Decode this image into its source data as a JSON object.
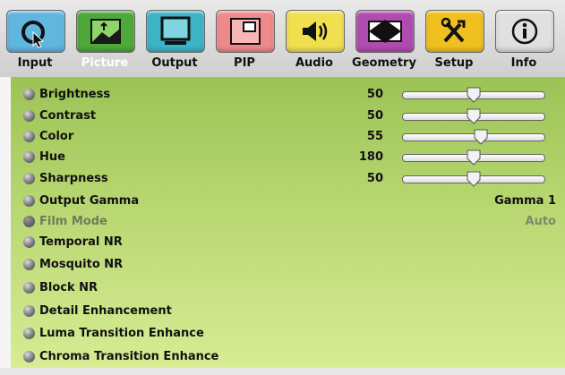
{
  "colors": {
    "input": "#5fb7e0",
    "picture": "#4fa83a",
    "output": "#3bb4c8",
    "pip": "#f08a8a",
    "audio": "#f0e050",
    "geometry": "#b04cb0",
    "setup": "#f0c020",
    "info": "#e0e0e0",
    "content_top": "#9cc356",
    "content_bottom": "#d8ec94"
  },
  "tabs": [
    {
      "label": "Input",
      "icon": "cursor-icon"
    },
    {
      "label": "Picture",
      "icon": "image-icon"
    },
    {
      "label": "Output",
      "icon": "monitor-icon"
    },
    {
      "label": "PIP",
      "icon": "pip-icon"
    },
    {
      "label": "Audio",
      "icon": "speaker-icon"
    },
    {
      "label": "Geometry",
      "icon": "geometry-icon"
    },
    {
      "label": "Setup",
      "icon": "tools-icon"
    },
    {
      "label": "Info",
      "icon": "info-icon"
    }
  ],
  "active_tab": "Picture",
  "settings": [
    {
      "label": "Brightness",
      "value": "50",
      "level": 50
    },
    {
      "label": "Contrast",
      "value": "50",
      "level": 50
    },
    {
      "label": "Color",
      "value": "55",
      "level": 55
    },
    {
      "label": "Hue",
      "value": "180",
      "level": 50
    },
    {
      "label": "Sharpness",
      "value": "50",
      "level": 50
    },
    {
      "label": "Output Gamma",
      "value": "Gamma 1"
    },
    {
      "label": "Film Mode",
      "value": "Auto",
      "disabled": true
    },
    {
      "label": "Temporal NR"
    },
    {
      "label": "Mosquito NR"
    },
    {
      "label": "Block NR"
    },
    {
      "label": "Detail Enhancement"
    },
    {
      "label": "Luma Transition Enhance"
    },
    {
      "label": "Chroma Transition Enhance"
    }
  ]
}
